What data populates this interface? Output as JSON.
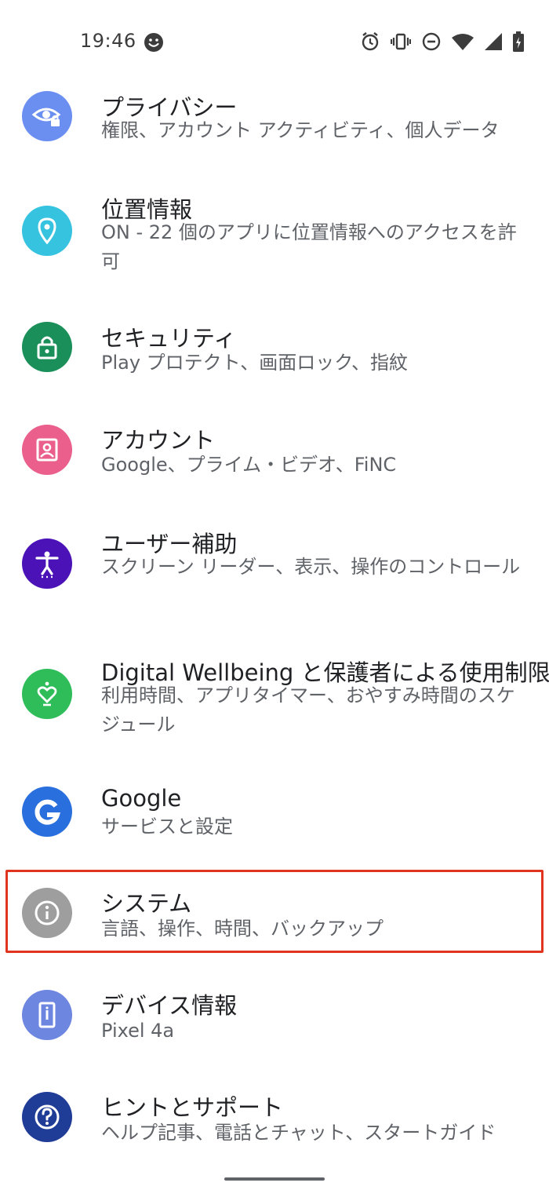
{
  "status_bar": {
    "time": "19:46",
    "icons": [
      "face-icon",
      "alarm-icon",
      "vibrate-icon",
      "do-not-disturb-icon",
      "wifi-icon",
      "signal-icon",
      "battery-charging-icon"
    ]
  },
  "items": [
    {
      "title": "プライバシー",
      "subtitle": "権限、アカウント アクティビティ、個人データ",
      "icon": "privacy-eye-icon",
      "color": "#6b8ff0"
    },
    {
      "title": "位置情報",
      "subtitle": "ON - 22 個のアプリに位置情報へのアクセスを許可",
      "icon": "location-pin-icon",
      "color": "#35c3df"
    },
    {
      "title": "セキュリティ",
      "subtitle": "Play プロテクト、画面ロック、指紋",
      "icon": "lock-icon",
      "color": "#1b8f5a"
    },
    {
      "title": "アカウント",
      "subtitle": "Google、プライム・ビデオ、FiNC",
      "icon": "account-box-icon",
      "color": "#ea5f8b"
    },
    {
      "title": "ユーザー補助",
      "subtitle": "スクリーン リーダー、表示、操作のコントロール",
      "icon": "accessibility-icon",
      "color": "#4b12b8"
    },
    {
      "title": "Digital Wellbeing と保護者による使用制限",
      "subtitle": "利用時間、アプリタイマー、おやすみ時間のスケジュール",
      "icon": "wellbeing-heart-icon",
      "color": "#2fbd5a"
    },
    {
      "title": "Google",
      "subtitle": "サービスと設定",
      "icon": "google-g-icon",
      "color": "#2a6fde"
    },
    {
      "title": "システム",
      "subtitle": "言語、操作、時間、バックアップ",
      "icon": "info-icon",
      "color": "#9e9e9e"
    },
    {
      "title": "デバイス情報",
      "subtitle": "Pixel 4a",
      "icon": "phone-info-icon",
      "color": "#6d86e0"
    },
    {
      "title": "ヒントとサポート",
      "subtitle": "ヘルプ記事、電話とチャット、スタートガイド",
      "icon": "help-icon",
      "color": "#1f3c96"
    }
  ],
  "highlighted_item": "システム"
}
